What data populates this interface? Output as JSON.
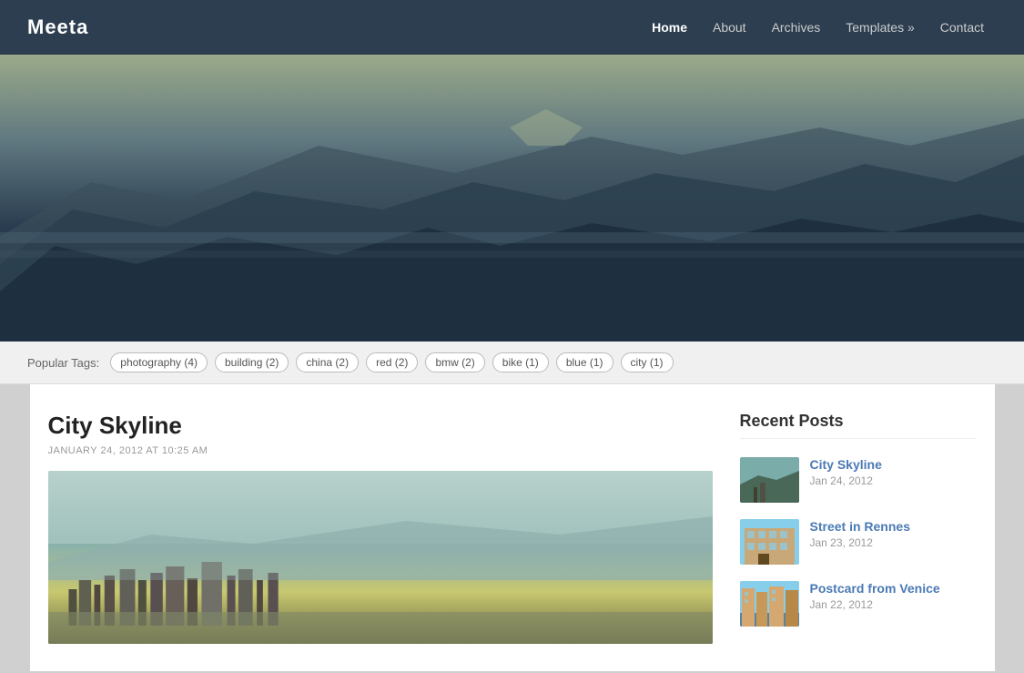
{
  "header": {
    "logo": "Meeta",
    "nav": [
      {
        "label": "Home",
        "active": true
      },
      {
        "label": "About",
        "active": false
      },
      {
        "label": "Archives",
        "active": false
      },
      {
        "label": "Templates »",
        "active": false
      },
      {
        "label": "Contact",
        "active": false
      }
    ]
  },
  "tags": {
    "label": "Popular Tags:",
    "items": [
      {
        "name": "photography",
        "count": "(4)"
      },
      {
        "name": "building",
        "count": "(2)"
      },
      {
        "name": "china",
        "count": "(2)"
      },
      {
        "name": "red",
        "count": "(2)"
      },
      {
        "name": "bmw",
        "count": "(2)"
      },
      {
        "name": "bike",
        "count": "(1)"
      },
      {
        "name": "blue",
        "count": "(1)"
      },
      {
        "name": "city",
        "count": "(1)"
      }
    ]
  },
  "main_post": {
    "title": "City Skyline",
    "date": "JANUARY 24, 2012 AT 10:25 AM"
  },
  "sidebar": {
    "recent_posts_title": "Recent Posts",
    "posts": [
      {
        "title": "City Skyline",
        "date": "Jan 24, 2012"
      },
      {
        "title": "Street in Rennes",
        "date": "Jan 23, 2012"
      },
      {
        "title": "Postcard from Venice",
        "date": "Jan 22, 2012"
      }
    ]
  }
}
